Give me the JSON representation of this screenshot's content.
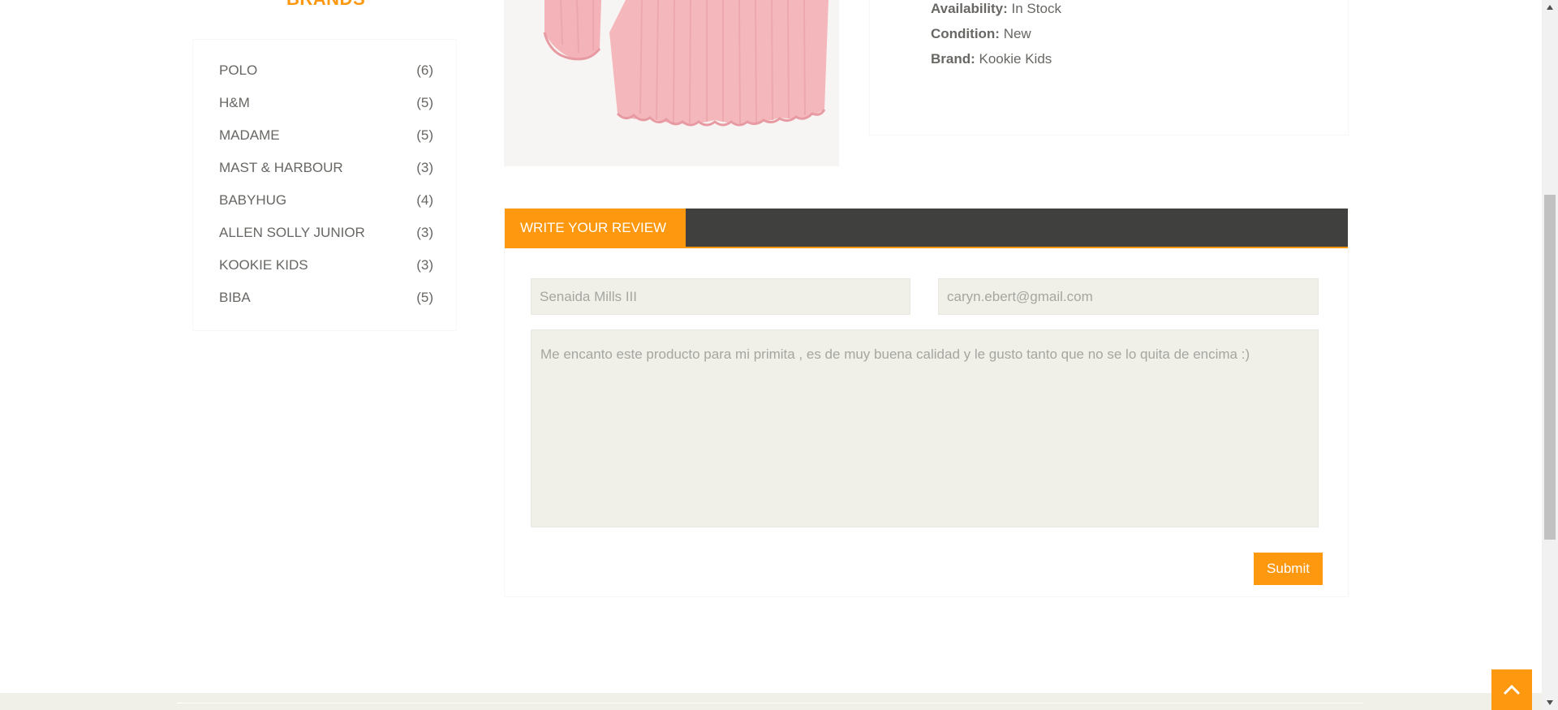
{
  "sidebar": {
    "title": "BRANDS",
    "brands": [
      {
        "name": "POLO",
        "count": "(6)"
      },
      {
        "name": "H&M",
        "count": "(5)"
      },
      {
        "name": "MADAME",
        "count": "(5)"
      },
      {
        "name": "MAST & HARBOUR",
        "count": "(3)"
      },
      {
        "name": "BABYHUG",
        "count": "(4)"
      },
      {
        "name": "ALLEN SOLLY JUNIOR",
        "count": "(3)"
      },
      {
        "name": "KOOKIE KIDS",
        "count": "(3)"
      },
      {
        "name": "BIBA",
        "count": "(5)"
      }
    ]
  },
  "product": {
    "availability_label": "Availability:",
    "availability_value": "In Stock",
    "condition_label": "Condition:",
    "condition_value": "New",
    "brand_label": "Brand:",
    "brand_value": "Kookie Kids"
  },
  "review": {
    "tab_label": "WRITE YOUR REVIEW",
    "name_value": "Senaida Mills III",
    "email_value": "caryn.ebert@gmail.com",
    "review_text": "Me encanto este producto para mi primita , es de muy buena calidad y le gusto tanto que no se lo quita de encima :)",
    "submit_label": "Submit"
  },
  "colors": {
    "accent": "#FE980F",
    "dark_bar": "#40403e",
    "field_bg": "#F0F0E9",
    "text": "#696763"
  },
  "icons": {
    "scroll_up": "chevron-up-icon",
    "scrollbar_up": "triangle-up-icon",
    "scrollbar_down": "triangle-down-icon"
  }
}
